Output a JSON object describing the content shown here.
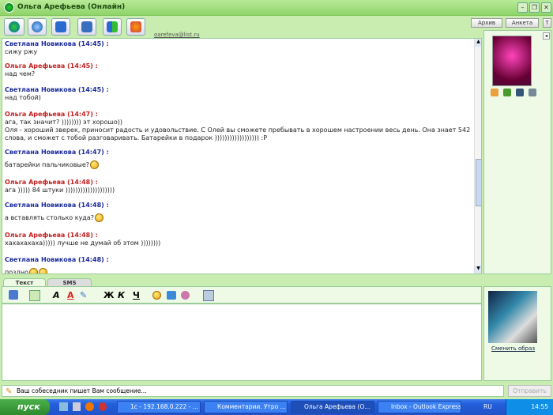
{
  "window": {
    "title": "Ольга Арефьева (Онлайн)",
    "email": "oarefeva@list.ru",
    "archive": "Архив",
    "profile": "Анкета"
  },
  "messages": [
    {
      "author": "Светлана Новикова",
      "time": "(14:45) :",
      "text": "сижу ржу",
      "side": "sv"
    },
    {
      "author": "Ольга Арефьева",
      "time": "(14:45) :",
      "text": "над чем?",
      "side": "ol"
    },
    {
      "author": "Светлана Новикова",
      "time": "(14:45) :",
      "text": "над тобой)",
      "side": "sv"
    },
    {
      "author": "Ольга Арефьева",
      "time": "(14:47) :",
      "text": "ага, так значит? )))))))) эт хорошо))",
      "text2": " Оля - хороший зверек, приносит радость и удовольствие. С Олей вы сможете пребывать в хорошем настроении весь день. Она знает 542 слова, и сможет с тобой разговаривать. Батарейки в подарок )))))))))))))))))) :P",
      "side": "ol"
    },
    {
      "author": "Светлана Новикова",
      "time": "(14:47) :",
      "text": "батарейки пальчиковые?",
      "side": "sv",
      "smiles": 1
    },
    {
      "author": "Ольга Арефьева",
      "time": "(14:48) :",
      "text": "ага ))))) 84 штуки ))))))))))))))))))))",
      "side": "ol"
    },
    {
      "author": "Светлана Новикова",
      "time": "(14:48) :",
      "text": "а вставлять столько куда?",
      "side": "sv",
      "smiles": 1
    },
    {
      "author": "Ольга Арефьева",
      "time": "(14:48) :",
      "text": "хахахахаха))))) лучше не думай об этом ))))))))",
      "side": "ol"
    },
    {
      "author": "Светлана Новикова",
      "time": "(14:48) :",
      "text": "поздно",
      "side": "sv",
      "smiles": 2
    }
  ],
  "tabs": [
    "Текст",
    "SMS"
  ],
  "side": {
    "change_image": "Сменить образ"
  },
  "status": {
    "typing": "Ваш собеседник пишет Вам сообщение...",
    "send": "Отправить"
  },
  "taskbar": {
    "start": "пуск",
    "tasks": [
      "1с - 192.168.0.222 - ...",
      "Комментарии. Утро ...",
      "Ольга Арефьева (О...",
      "Inbox - Outlook Express"
    ],
    "lang": "RU",
    "clock": "14:55"
  },
  "format": {
    "bold": "Ж",
    "italic": "К",
    "underline": "Ч"
  }
}
